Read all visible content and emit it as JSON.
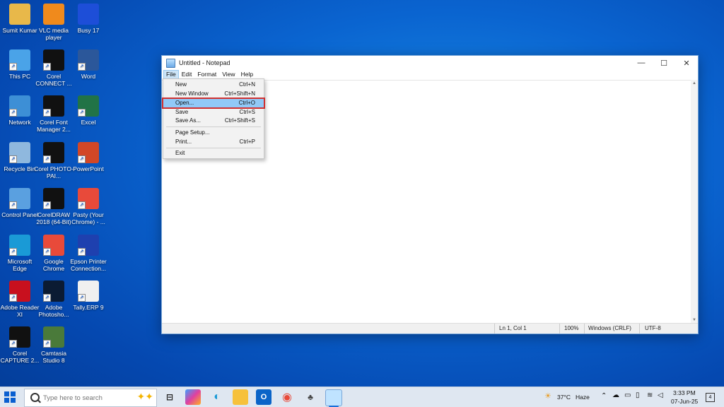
{
  "desktop": {
    "icons": [
      {
        "label": "Sumit Kumar",
        "icon": "user-folder-icon",
        "color": "#e8b84a"
      },
      {
        "label": "VLC media player",
        "icon": "vlc-icon",
        "color": "#f08a1c"
      },
      {
        "label": "Busy 17",
        "icon": "busy-icon",
        "color": "#1d4ed8"
      },
      {
        "label": "This PC",
        "icon": "computer-icon",
        "color": "#4aa3e8"
      },
      {
        "label": "Corel CONNECT ...",
        "icon": "corel-connect-icon",
        "color": "#111111"
      },
      {
        "label": "Word",
        "icon": "word-icon",
        "color": "#2b579a"
      },
      {
        "label": "Network",
        "icon": "network-icon",
        "color": "#3d8fd6"
      },
      {
        "label": "Corel Font Manager 2...",
        "icon": "corel-font-manager-icon",
        "color": "#111111"
      },
      {
        "label": "Excel",
        "icon": "excel-icon",
        "color": "#217346"
      },
      {
        "label": "Recycle Bin",
        "icon": "recycle-bin-icon",
        "color": "#8fb8de"
      },
      {
        "label": "Corel PHOTO-PAI...",
        "icon": "corel-photo-paint-icon",
        "color": "#111111"
      },
      {
        "label": "PowerPoint",
        "icon": "powerpoint-icon",
        "color": "#d24726"
      },
      {
        "label": "Control Panel",
        "icon": "control-panel-icon",
        "color": "#5aa0e0"
      },
      {
        "label": "CorelDRAW 2018 (64-Bit)",
        "icon": "coreldraw-icon",
        "color": "#111111"
      },
      {
        "label": "Pasty (Your Chrome) - ...",
        "icon": "chrome-app-icon",
        "color": "#e84a3a"
      },
      {
        "label": "Microsoft Edge",
        "icon": "edge-icon",
        "color": "#1a9ad6"
      },
      {
        "label": "Google Chrome",
        "icon": "chrome-icon",
        "color": "#e84a3a"
      },
      {
        "label": "Epson Printer Connection...",
        "icon": "epson-printer-icon",
        "color": "#1e40af"
      },
      {
        "label": "Adobe Reader XI",
        "icon": "adobe-reader-icon",
        "color": "#c8101e"
      },
      {
        "label": "Adobe Photosho...",
        "icon": "photoshop-icon",
        "color": "#0b1b33"
      },
      {
        "label": "Tally.ERP 9",
        "icon": "tally-icon",
        "color": "#f0f0f0"
      },
      {
        "label": "Corel CAPTURE 2...",
        "icon": "corel-capture-icon",
        "color": "#111111"
      },
      {
        "label": "Camtasia Studio 8",
        "icon": "camtasia-icon",
        "color": "#4a7a3a"
      }
    ]
  },
  "notepad": {
    "title": "Untitled - Notepad",
    "window_buttons": {
      "minimize": "—",
      "maximize": "☐",
      "close": "✕"
    },
    "menu": [
      "File",
      "Edit",
      "Format",
      "View",
      "Help"
    ],
    "status": {
      "position": "Ln 1, Col 1",
      "zoom": "100%",
      "line_ending": "Windows (CRLF)",
      "encoding": "UTF-8"
    }
  },
  "file_menu": {
    "items": [
      {
        "label": "New",
        "shortcut": "Ctrl+N"
      },
      {
        "label": "New Window",
        "shortcut": "Ctrl+Shift+N"
      },
      {
        "label": "Open...",
        "shortcut": "Ctrl+O",
        "highlighted": true
      },
      {
        "label": "Save",
        "shortcut": "Ctrl+S"
      },
      {
        "label": "Save As...",
        "shortcut": "Ctrl+Shift+S"
      },
      {
        "label": "Page Setup...",
        "shortcut": ""
      },
      {
        "label": "Print...",
        "shortcut": "Ctrl+P"
      },
      {
        "label": "Exit",
        "shortcut": ""
      }
    ],
    "highlight_color": "#d03030"
  },
  "taskbar": {
    "search_placeholder": "Type here to search",
    "apps": [
      "task-view-icon",
      "copilot-icon",
      "edge-icon",
      "file-explorer-icon",
      "outlook-icon",
      "chrome-icon",
      "game-icon",
      "notepad-icon"
    ],
    "weather": {
      "temp": "37°C",
      "condition": "Haze"
    },
    "clock": {
      "time": "3:33 PM",
      "date": "07-Jun-25"
    },
    "notifications": "4"
  }
}
